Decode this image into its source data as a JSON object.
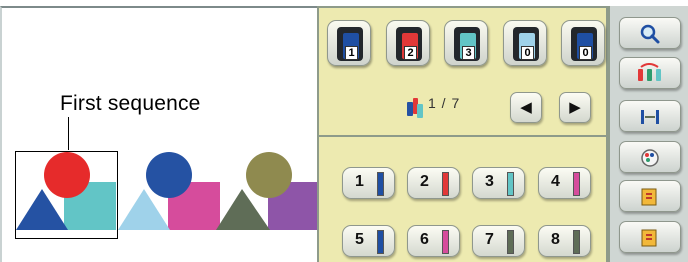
{
  "preview": {
    "callout_label": "First sequence"
  },
  "spools": [
    {
      "number": "1",
      "color": "#1f4fa3"
    },
    {
      "number": "2",
      "color": "#e23838"
    },
    {
      "number": "3",
      "color": "#62c5c6"
    },
    {
      "number": "0",
      "color": "#9fd2ea"
    },
    {
      "number": "0",
      "color": "#1f4fa3"
    }
  ],
  "navigation": {
    "page_indicator": "1 / 7",
    "prev_glyph": "◀",
    "next_glyph": "▶"
  },
  "sequence_buttons": [
    {
      "number": "1",
      "color": "#1f4fa3"
    },
    {
      "number": "2",
      "color": "#e23838"
    },
    {
      "number": "3",
      "color": "#62c5c6"
    },
    {
      "number": "4",
      "color": "#d64c9c"
    },
    {
      "number": "5",
      "color": "#1f4fa3"
    },
    {
      "number": "6",
      "color": "#d64c9c"
    },
    {
      "number": "7",
      "color": "#5f6d57"
    },
    {
      "number": "8",
      "color": "#5f6d57"
    }
  ],
  "right_buttons": [
    {
      "icon": "magnify-icon"
    },
    {
      "icon": "color-sort-icon"
    },
    {
      "icon": "needle-gap-icon"
    },
    {
      "icon": "color-palette-icon"
    },
    {
      "icon": "stitch-page-icon"
    },
    {
      "icon": "stitch-page-icon"
    }
  ],
  "motifs": [
    {
      "circle": "#e62b2b",
      "square": "#62c5c6",
      "triangle": "#2552a3"
    },
    {
      "circle": "#2552a3",
      "square": "#d64c9c",
      "triangle": "#9fd2ea"
    },
    {
      "circle": "#8f8a4f",
      "square": "#8e55a8",
      "triangle": "#5f6d57"
    }
  ]
}
